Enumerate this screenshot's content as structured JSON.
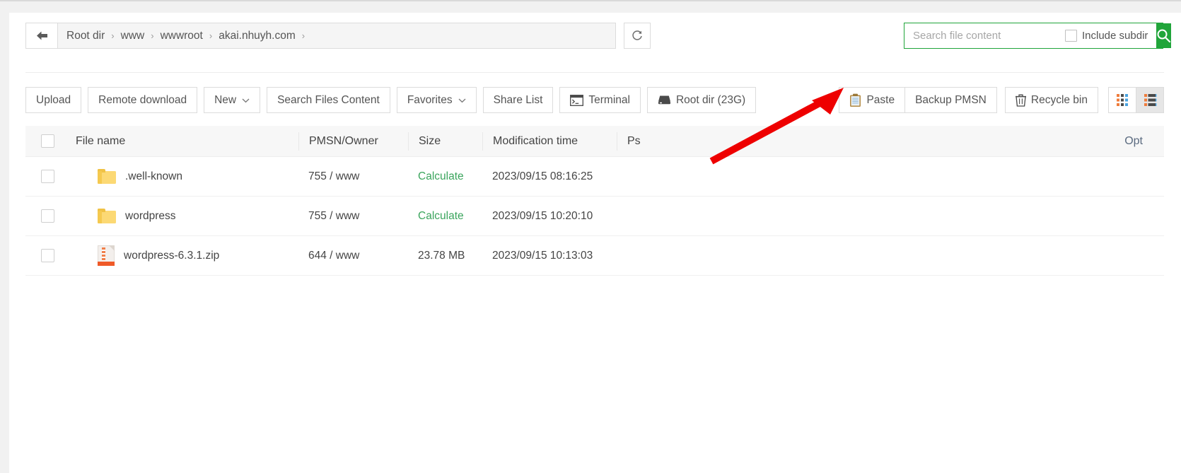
{
  "window": {
    "background": "#f1f1f1",
    "card_background": "#ffffff",
    "accent_green": "#20a53a"
  },
  "pathbar": {
    "back_icon": "arrow-left-icon",
    "crumbs": [
      "Root dir",
      "www",
      "wwwroot",
      "akai.nhuyh.com"
    ],
    "separator": "›",
    "trailing_separator": "›",
    "refresh_icon": "refresh-icon"
  },
  "search": {
    "placeholder": "Search file content",
    "value": "",
    "include_subdir_label": "Include subdir",
    "include_subdir_checked": false,
    "submit_icon": "search-icon"
  },
  "toolbar": {
    "left": [
      {
        "label": "Upload",
        "icon": null,
        "caret": false
      },
      {
        "label": "Remote download",
        "icon": null,
        "caret": false
      },
      {
        "label": "New",
        "icon": null,
        "caret": true
      },
      {
        "label": "Search Files Content",
        "icon": null,
        "caret": false
      },
      {
        "label": "Favorites",
        "icon": null,
        "caret": true
      },
      {
        "label": "Share List",
        "icon": null,
        "caret": false
      },
      {
        "label": "Terminal",
        "icon": "terminal-icon",
        "caret": false
      },
      {
        "label": "Root dir (23G)",
        "icon": "disk-icon",
        "caret": false
      }
    ],
    "right_group": [
      {
        "label": "Paste",
        "icon": "clipboard-icon"
      },
      {
        "label": "Backup PMSN",
        "icon": null
      }
    ],
    "recycle": {
      "label": "Recycle bin",
      "icon": "trash-icon"
    },
    "view_toggle": {
      "grid_icon": "grid-view-icon",
      "list_icon": "list-view-icon",
      "active": "list"
    }
  },
  "table": {
    "select_all_checked": false,
    "columns": [
      "File name",
      "PMSN/Owner",
      "Size",
      "Modification time",
      "Ps",
      "Opt"
    ],
    "rows": [
      {
        "checked": false,
        "icon": "folder-icon",
        "name": ".well-known",
        "pmsn": "755 / www",
        "size": "Calculate",
        "size_is_action": true,
        "mtime": "2023/09/15 08:16:25",
        "ps": "",
        "opt": ""
      },
      {
        "checked": false,
        "icon": "folder-icon",
        "name": "wordpress",
        "pmsn": "755 / www",
        "size": "Calculate",
        "size_is_action": true,
        "mtime": "2023/09/15 10:20:10",
        "ps": "",
        "opt": ""
      },
      {
        "checked": false,
        "icon": "zip-file-icon",
        "name": "wordpress-6.3.1.zip",
        "pmsn": "644 / www",
        "size": "23.78 MB",
        "size_is_action": false,
        "mtime": "2023/09/15 10:13:03",
        "ps": "",
        "opt": ""
      }
    ]
  },
  "annotation": {
    "type": "arrow",
    "color": "#ee0000",
    "points_to": "Paste"
  }
}
